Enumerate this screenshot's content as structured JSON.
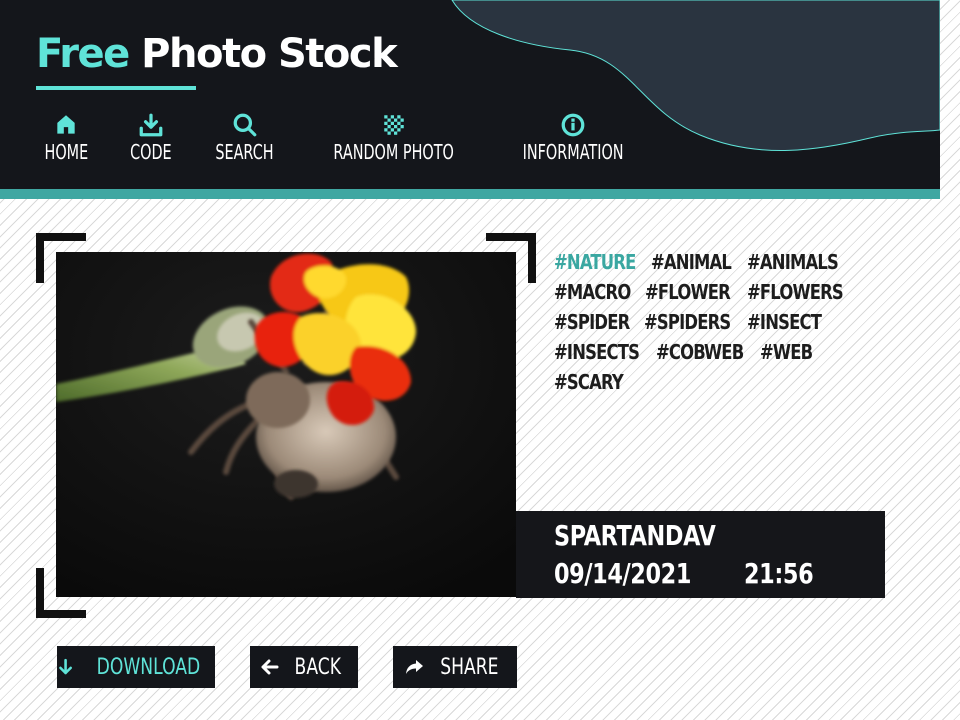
{
  "brand": {
    "free": "Free",
    "rest": " Photo Stock"
  },
  "nav": [
    {
      "label": "HOME",
      "icon": "home-icon"
    },
    {
      "label": "CODE",
      "icon": "download-icon"
    },
    {
      "label": "SEARCH",
      "icon": "search-icon"
    },
    {
      "label": "RANDOM PHOTO",
      "icon": "shuffle-icon"
    },
    {
      "label": "INFORMATION",
      "icon": "info-icon"
    }
  ],
  "photo": {
    "author": "SPARTANDAV",
    "date": "09/14/2021",
    "time": "21:56"
  },
  "tags": [
    {
      "label": "#NATURE",
      "active": true
    },
    {
      "label": "#ANIMAL",
      "active": false
    },
    {
      "label": "#ANIMALS",
      "active": false
    },
    {
      "label": "#MACRO",
      "active": false
    },
    {
      "label": "#FLOWER",
      "active": false
    },
    {
      "label": "#FLOWERS",
      "active": false
    },
    {
      "label": "#SPIDER",
      "active": false
    },
    {
      "label": "#SPIDERS",
      "active": false
    },
    {
      "label": "#INSECT",
      "active": false
    },
    {
      "label": "#INSECTS",
      "active": false
    },
    {
      "label": "#COBWEB",
      "active": false
    },
    {
      "label": "#WEB",
      "active": false
    },
    {
      "label": "#SCARY",
      "active": false
    }
  ],
  "buttons": {
    "download": "DOWNLOAD",
    "back": "BACK",
    "share": "SHARE"
  },
  "colors": {
    "accent": "#5fe3d8",
    "accent_dark": "#3aa7a1",
    "header_bg": "#14161b",
    "text_dark": "#1d1d1d"
  }
}
